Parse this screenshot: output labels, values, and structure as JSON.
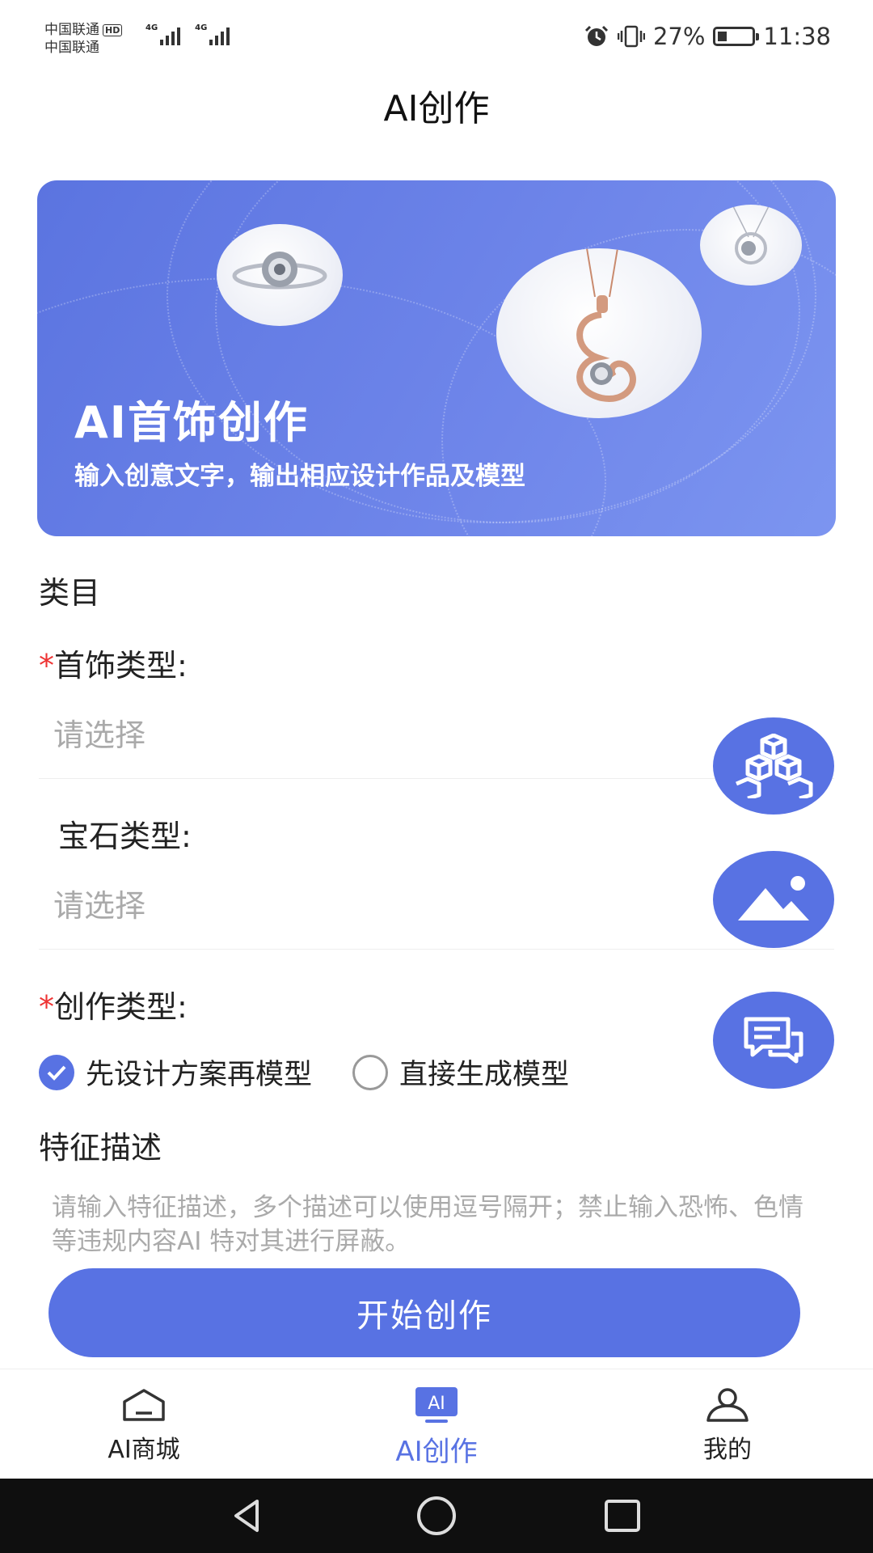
{
  "status": {
    "carrier1": "中国联通",
    "carrier2": "中国联通",
    "hd": "HD",
    "net1": "4G",
    "net2": "4G",
    "battery": "27%",
    "battery_level": 0.27,
    "time": "11:38"
  },
  "header": {
    "title": "AI创作"
  },
  "banner": {
    "title": "AI首饰创作",
    "subtitle": "输入创意文字，输出相应设计作品及模型"
  },
  "form": {
    "category_label": "类目",
    "required_mark": "*",
    "jewelry_type": {
      "label": "首饰类型:",
      "placeholder": "请选择"
    },
    "gem_type": {
      "label": "宝石类型:",
      "placeholder": "请选择"
    },
    "creation_type": {
      "label": "创作类型:",
      "options": [
        {
          "label": "先设计方案再模型",
          "selected": true
        },
        {
          "label": "直接生成模型",
          "selected": false
        }
      ]
    },
    "feature_label": "特征描述",
    "feature_placeholder": "请输入特征描述，多个描述可以使用逗号隔开；禁止输入恐怖、色情等违规内容AI 特对其进行屏蔽。",
    "submit": "开始创作"
  },
  "fabs": [
    "cubes-icon",
    "image-icon",
    "chat-icon"
  ],
  "tabbar": {
    "items": [
      {
        "label": "AI商城",
        "icon": "home-icon",
        "active": false
      },
      {
        "label": "AI创作",
        "icon": "ai-icon",
        "icon_text": "AI",
        "active": true
      },
      {
        "label": "我的",
        "icon": "user-icon",
        "active": false
      }
    ]
  },
  "colors": {
    "accent": "#5872e3",
    "required": "#e33333"
  }
}
